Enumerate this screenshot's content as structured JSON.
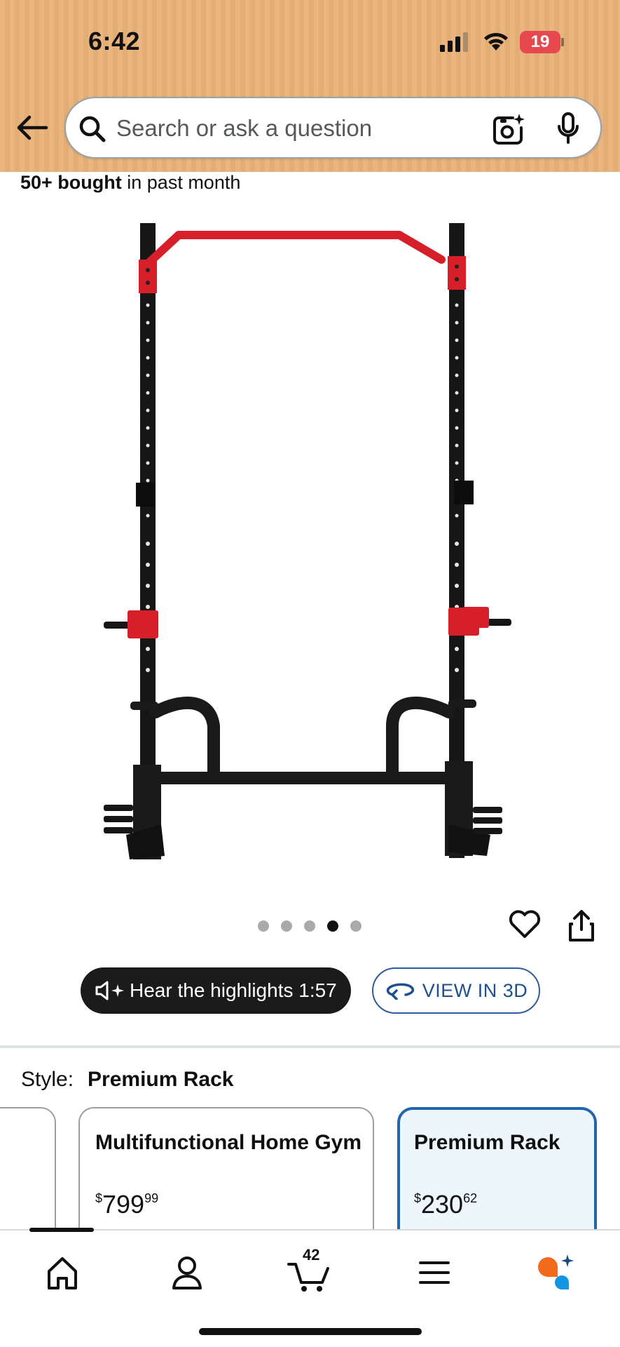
{
  "status_bar": {
    "time": "6:42",
    "battery": "19"
  },
  "search": {
    "placeholder": "Search or ask a question"
  },
  "product": {
    "bought_count": "50+ bought",
    "bought_suffix": " in past month",
    "image_count": 5,
    "active_image_index": 3
  },
  "actions": {
    "hear_label": "Hear the highlights 1:57",
    "view3d_label": "VIEW IN 3D"
  },
  "style": {
    "label": "Style:",
    "selected": "Premium Rack",
    "options": [
      {
        "title": "Multifunctional Home Gym",
        "price_symbol": "$",
        "price_whole": "799",
        "price_fraction": "99"
      },
      {
        "title": "Premium Rack",
        "price_symbol": "$",
        "price_whole": "230",
        "price_fraction": "62"
      }
    ]
  },
  "nav": {
    "cart_count": "42"
  },
  "colors": {
    "header": "#e9b680",
    "accent_blue": "#2463ae",
    "rack_red": "#d71f2a",
    "battery": "#e5484d"
  }
}
